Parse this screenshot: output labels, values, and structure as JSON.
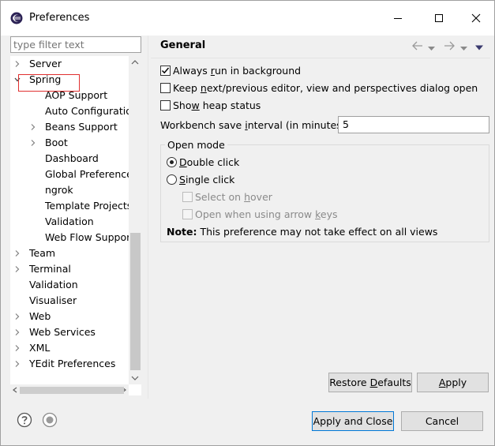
{
  "window": {
    "title": "Preferences"
  },
  "filter": {
    "placeholder": "type filter text"
  },
  "tree": [
    {
      "label": "Server",
      "arrow": "right",
      "level": 0
    },
    {
      "label": "Spring",
      "arrow": "down",
      "level": 0
    },
    {
      "label": "AOP Support",
      "arrow": "none",
      "level": 1
    },
    {
      "label": "Auto Configuration",
      "arrow": "none",
      "level": 1
    },
    {
      "label": "Beans Support",
      "arrow": "right",
      "level": 1
    },
    {
      "label": "Boot",
      "arrow": "right",
      "level": 1
    },
    {
      "label": "Dashboard",
      "arrow": "none",
      "level": 1
    },
    {
      "label": "Global Preferences",
      "arrow": "none",
      "level": 1
    },
    {
      "label": "ngrok",
      "arrow": "none",
      "level": 1
    },
    {
      "label": "Template Projects",
      "arrow": "none",
      "level": 1
    },
    {
      "label": "Validation",
      "arrow": "none",
      "level": 1
    },
    {
      "label": "Web Flow Support",
      "arrow": "none",
      "level": 1
    },
    {
      "label": "Team",
      "arrow": "right",
      "level": 0
    },
    {
      "label": "Terminal",
      "arrow": "right",
      "level": 0
    },
    {
      "label": "Validation",
      "arrow": "none",
      "level": 0
    },
    {
      "label": "Visualiser",
      "arrow": "none",
      "level": 0
    },
    {
      "label": "Web",
      "arrow": "right",
      "level": 0
    },
    {
      "label": "Web Services",
      "arrow": "right",
      "level": 0
    },
    {
      "label": "XML",
      "arrow": "right",
      "level": 0
    },
    {
      "label": "YEdit Preferences",
      "arrow": "right",
      "level": 0
    }
  ],
  "page": {
    "title": "General",
    "always_run": {
      "pre": "Always ",
      "u": "r",
      "post": "un in background",
      "checked": true
    },
    "keep_next": {
      "pre": "Keep ",
      "u": "n",
      "post": "ext/previous editor, view and perspectives dialog open",
      "checked": false
    },
    "show_heap": {
      "pre": "Sho",
      "u": "w",
      "post": " heap status",
      "checked": false
    },
    "save_interval": {
      "pre": "Workbench save ",
      "u": "i",
      "post": "nterval (in minutes):",
      "value": "5"
    },
    "open_mode": {
      "title": "Open mode",
      "double": {
        "pre": "",
        "u": "D",
        "post": "ouble click",
        "selected": true
      },
      "single": {
        "pre": "",
        "u": "S",
        "post": "ingle click",
        "selected": false
      },
      "select_hover": {
        "pre": "Select on ",
        "u": "h",
        "post": "over"
      },
      "open_arrow": {
        "pre": "Open when using arrow ",
        "u": "k",
        "post": "eys"
      },
      "note_label": "Note:",
      "note_text": "This preference may not take effect on all views"
    }
  },
  "buttons": {
    "restore": {
      "pre": "Restore ",
      "u": "D",
      "post": "efaults"
    },
    "apply": {
      "pre": "",
      "u": "A",
      "post": "pply"
    },
    "apply_close": "Apply and Close",
    "cancel": "Cancel"
  },
  "icons": {
    "app": "eclipse-icon",
    "help": "help-icon",
    "import": "import-export-icon",
    "back": "back-arrow-icon",
    "forward": "forward-arrow-icon",
    "menu": "view-menu-icon"
  }
}
